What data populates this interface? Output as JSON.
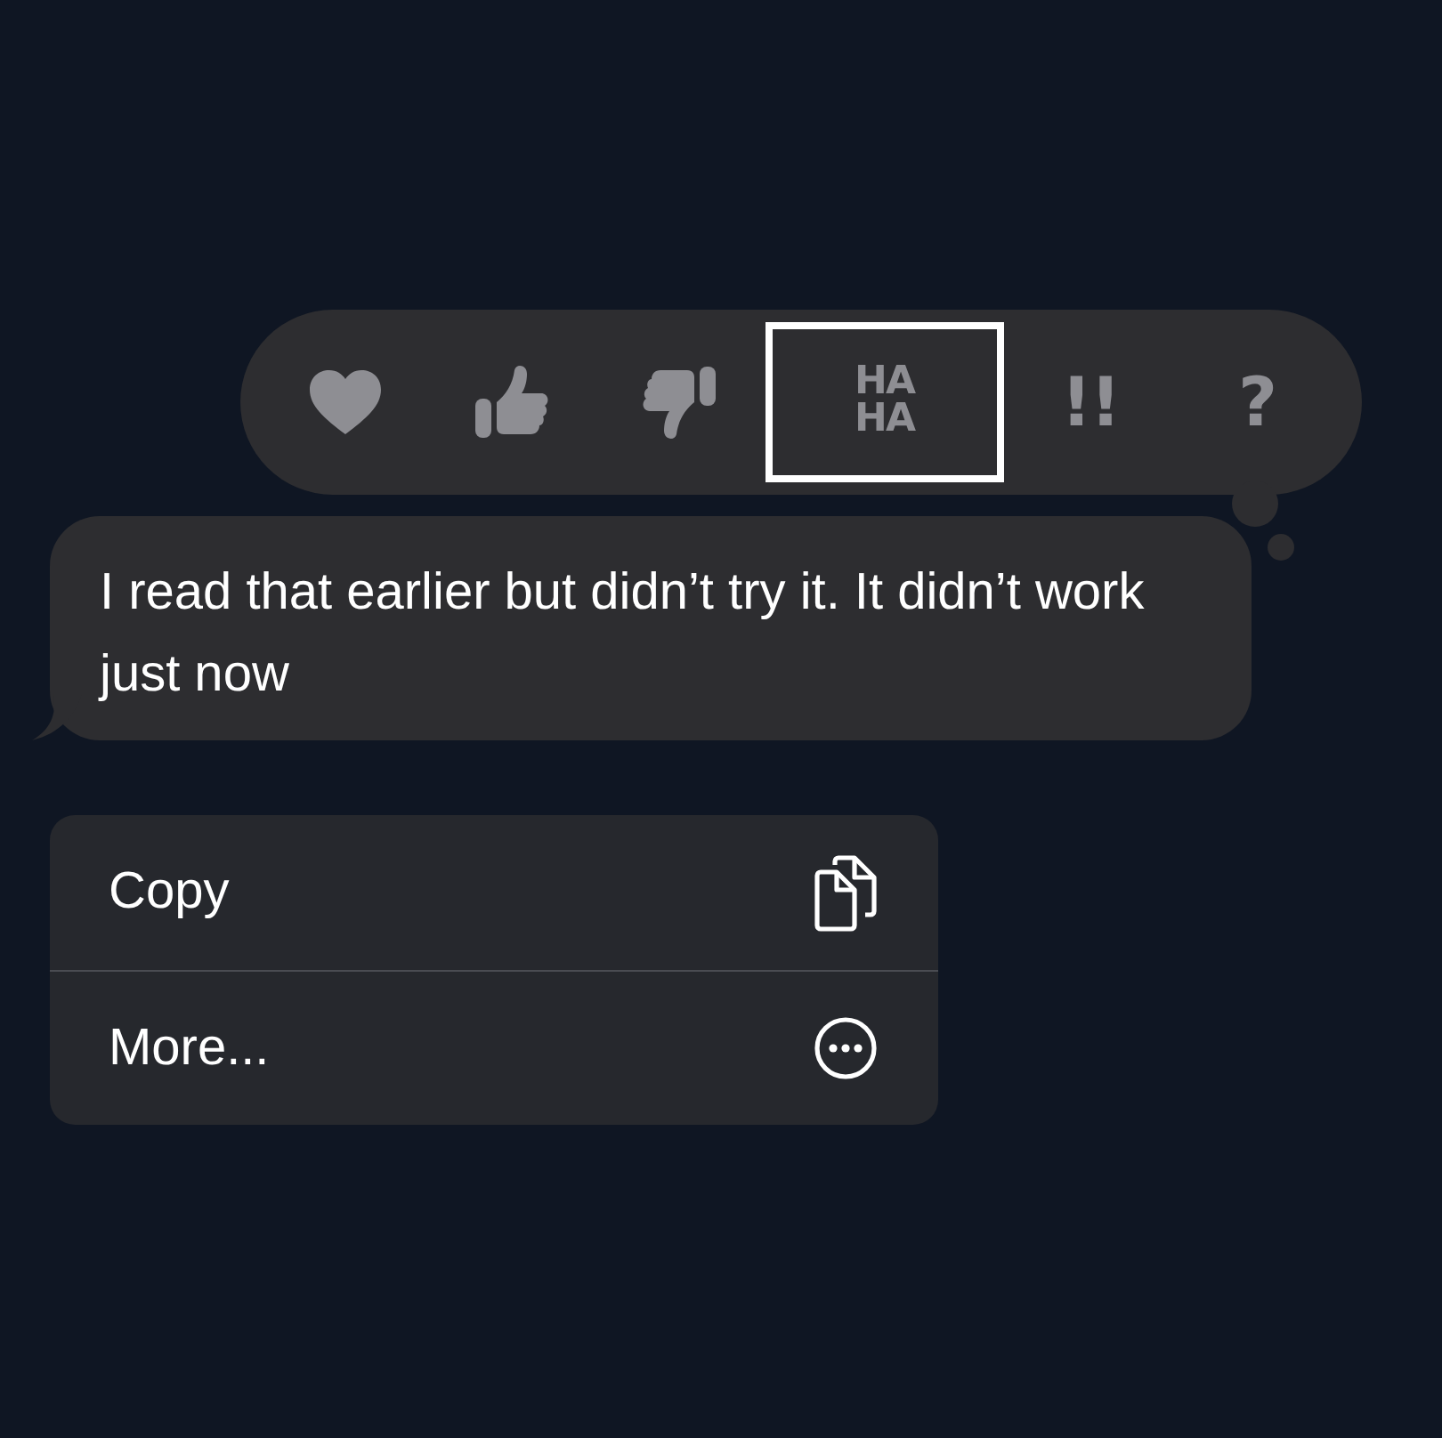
{
  "reactions": [
    {
      "kind": "heart",
      "selected": false
    },
    {
      "kind": "thumbs-up",
      "selected": false
    },
    {
      "kind": "thumbs-down",
      "selected": false
    },
    {
      "kind": "text",
      "label": "HA HA",
      "selected": true
    },
    {
      "kind": "text",
      "label": "!!",
      "selected": false
    },
    {
      "kind": "text",
      "label": "?",
      "selected": false
    }
  ],
  "message": {
    "text": "I read that earlier but didn’t try it. It didn’t work just now"
  },
  "menu": [
    {
      "label": "Copy",
      "kind": "copy"
    },
    {
      "label": "More...",
      "kind": "more"
    }
  ]
}
